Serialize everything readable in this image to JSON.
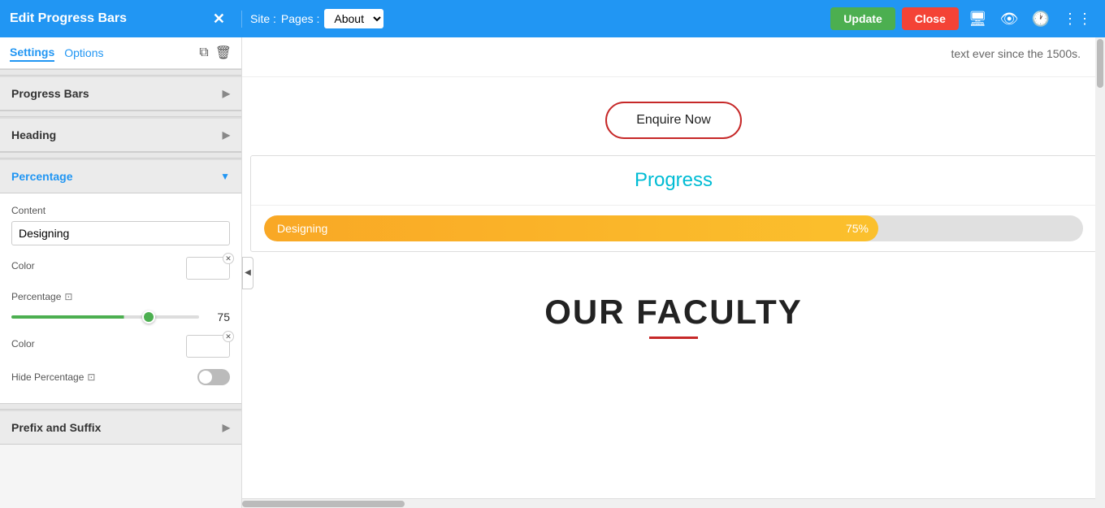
{
  "topBar": {
    "title": "Edit Progress Bars",
    "siteLabel": "Site :",
    "pagesLabel": "Pages :",
    "pagesOptions": [
      "About"
    ],
    "pagesSelected": "About",
    "updateLabel": "Update",
    "closeLabel": "Close"
  },
  "leftPanel": {
    "tabs": [
      {
        "id": "settings",
        "label": "Settings",
        "active": true
      },
      {
        "id": "options",
        "label": "Options",
        "active": false
      }
    ],
    "sections": [
      {
        "id": "progress-bars",
        "label": "Progress Bars",
        "expanded": false
      },
      {
        "id": "heading",
        "label": "Heading",
        "expanded": false
      },
      {
        "id": "percentage",
        "label": "Percentage",
        "expanded": true
      },
      {
        "id": "prefix-suffix",
        "label": "Prefix and Suffix",
        "expanded": false
      }
    ],
    "percentageSection": {
      "contentLabel": "Content",
      "contentValue": "Designing",
      "contentPlaceholder": "Designing",
      "colorLabel": "Color",
      "percentageLabel": "Percentage",
      "sliderValue": 75,
      "sliderMin": 0,
      "sliderMax": 100,
      "colorLabel2": "Color",
      "hidePercentageLabel": "Hide Percentage",
      "hidePercentageOn": false
    }
  },
  "rightPanel": {
    "topText": "text ever since the 1500s.",
    "enquireButton": "Enquire Now",
    "progressTitle": "Progress",
    "progressBars": [
      {
        "label": "Designing",
        "percent": 75,
        "percentLabel": "75%",
        "color": "#f9a825"
      }
    ],
    "facultyTitle": "OUR FACULTY"
  },
  "icons": {
    "close": "✕",
    "chevronRight": "▶",
    "chevronDown": "▼",
    "monitor": "⊡",
    "copy": "⧉",
    "trash": "🗑",
    "collapseLeft": "◀",
    "desktop": "🖥",
    "eye": "👁",
    "history": "🕐",
    "tree": "⋮"
  }
}
